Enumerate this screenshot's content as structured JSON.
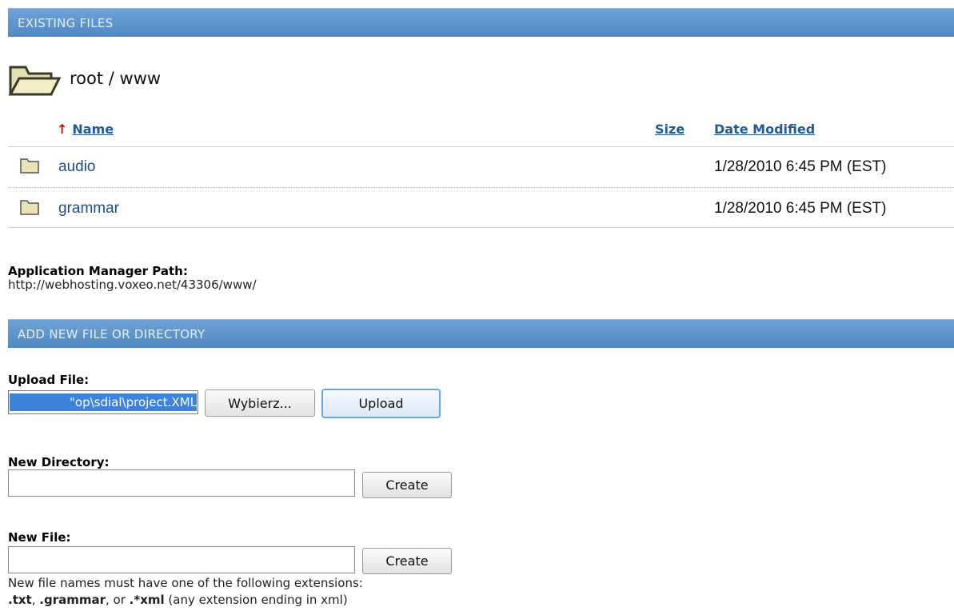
{
  "existing": {
    "header": "EXISTING FILES",
    "path": "root / www",
    "columns": {
      "name": "Name",
      "size": "Size",
      "date": "Date Modified"
    },
    "sort_arrow": "↑",
    "rows": [
      {
        "name": "audio",
        "size": "",
        "date": "1/28/2010 6:45 PM (EST)"
      },
      {
        "name": "grammar",
        "size": "",
        "date": "1/28/2010 6:45 PM (EST)"
      }
    ]
  },
  "app_path": {
    "label": "Application Manager Path:",
    "url": "http://webhosting.voxeo.net/43306/www/"
  },
  "add": {
    "header": "ADD NEW FILE OR DIRECTORY",
    "upload_label": "Upload File:",
    "upload_value": "op\\sdial\\project.XML\"",
    "browse_button": "Wybierz...",
    "upload_button": "Upload",
    "new_dir_label": "New Directory:",
    "new_dir_value": "",
    "create_dir_button": "Create",
    "new_file_label": "New File:",
    "new_file_value": "",
    "create_file_button": "Create",
    "note_line1": "New file names must have one of the following extensions:",
    "ext_txt": ".txt",
    "sep1": ", ",
    "ext_grammar": ".grammar",
    "sep2": ", or ",
    "ext_xml": ".*xml",
    "note_tail": " (any extension ending in xml)"
  },
  "colors": {
    "header_bg": "#5a93cb",
    "header_text": "#e6eef8",
    "link": "#1f5a99",
    "selection": "#3d82dd",
    "folder_fill": "#e9e3b5"
  },
  "icons": {
    "path_folder": "open-folder-icon",
    "row_folder": "folder-icon"
  }
}
